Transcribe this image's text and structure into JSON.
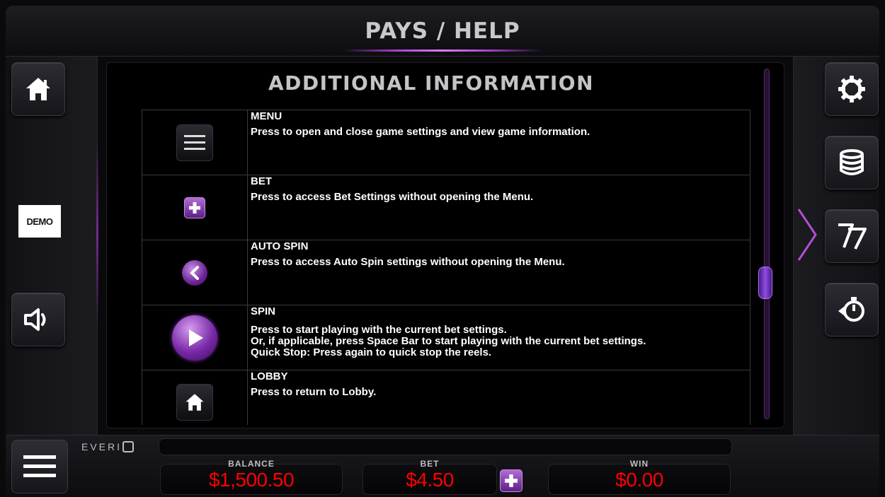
{
  "header": {
    "title": "PAYS / HELP"
  },
  "left_rail": {
    "home_icon": "home-icon",
    "demo_label": "DEMO",
    "sound_icon": "speaker-icon"
  },
  "right_rail": {
    "icons": [
      "gear-icon",
      "coins-stack-icon",
      "sevens-icon",
      "timer-icon"
    ]
  },
  "panel": {
    "title": "ADDITIONAL INFORMATION",
    "rows": [
      {
        "title": "MENU",
        "description": "Press to open and close game settings and view game information.",
        "icon": "hamburger-icon"
      },
      {
        "title": "BET",
        "description": "Press to access Bet Settings without opening the Menu.",
        "icon": "plus-icon"
      },
      {
        "title": "AUTO SPIN",
        "description": "Press to access Auto Spin settings without opening the Menu.",
        "icon": "chevron-left-icon"
      },
      {
        "title": "SPIN",
        "description": "Press to start playing with the current bet settings.\nOr, if applicable, press Space Bar to start playing with the current bet settings.\nQuick Stop: Press again to quick stop the reels.",
        "icon": "play-icon"
      },
      {
        "title": "LOBBY",
        "description": "Press to return to Lobby.",
        "icon": "home-icon"
      }
    ]
  },
  "footer": {
    "brand": "EVERI",
    "balance_label": "BALANCE",
    "balance_value": "$1,500.50",
    "bet_label": "BET",
    "bet_value": "$4.50",
    "win_label": "WIN",
    "win_value": "$0.00"
  },
  "colors": {
    "accent": "#8f4ee0",
    "meter_value": "#ff0000"
  }
}
